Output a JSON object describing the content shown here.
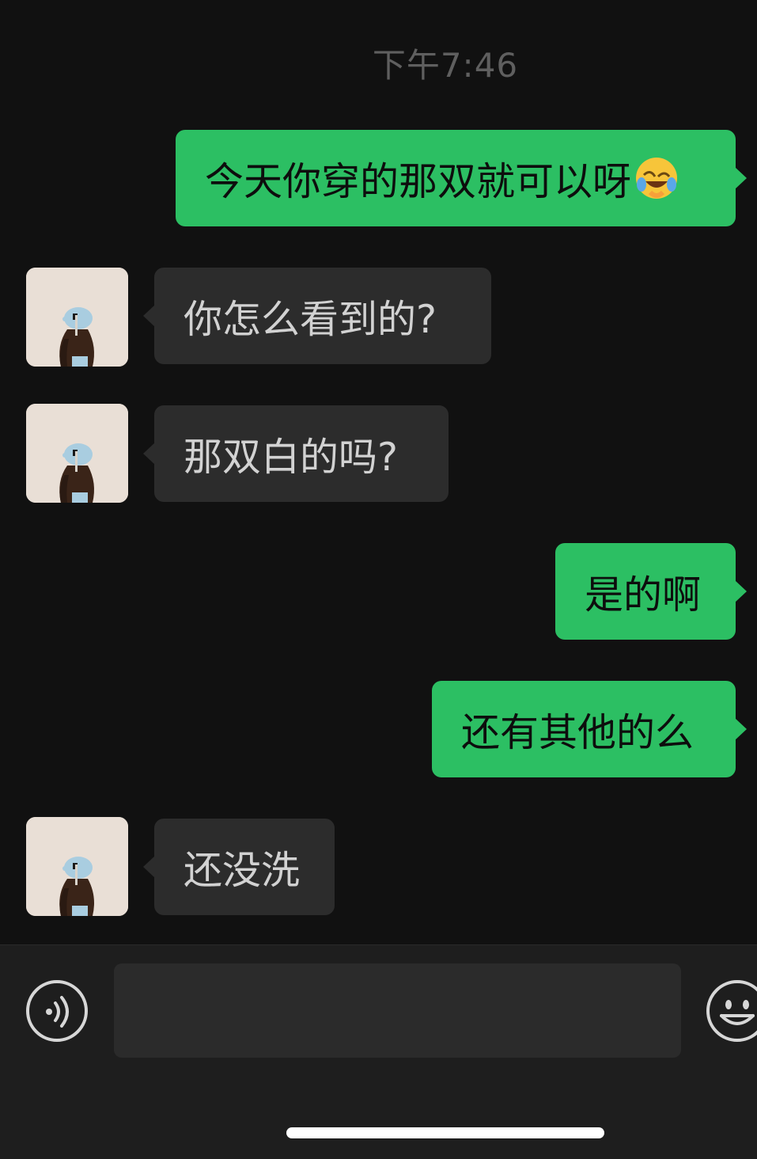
{
  "chat": {
    "timestamp": "下午7:46",
    "messages": [
      {
        "direction": "sent",
        "text": "今天你穿的那双就可以呀",
        "emoji": "face-with-tears-of-joy-emoji"
      },
      {
        "direction": "received",
        "text": "你怎么看到的?"
      },
      {
        "direction": "received",
        "text": "那双白的吗?"
      },
      {
        "direction": "sent",
        "text": "是的啊"
      },
      {
        "direction": "sent",
        "text": "还有其他的么"
      },
      {
        "direction": "received",
        "text": "还没洗"
      }
    ]
  },
  "input_bar": {
    "voice_icon": "voice-input-icon",
    "text_value": "",
    "emoji_icon": "emoji-smiley-icon"
  },
  "colors": {
    "sent_bubble": "#2cbf63",
    "received_bubble": "#2c2c2c",
    "background": "#111111"
  }
}
